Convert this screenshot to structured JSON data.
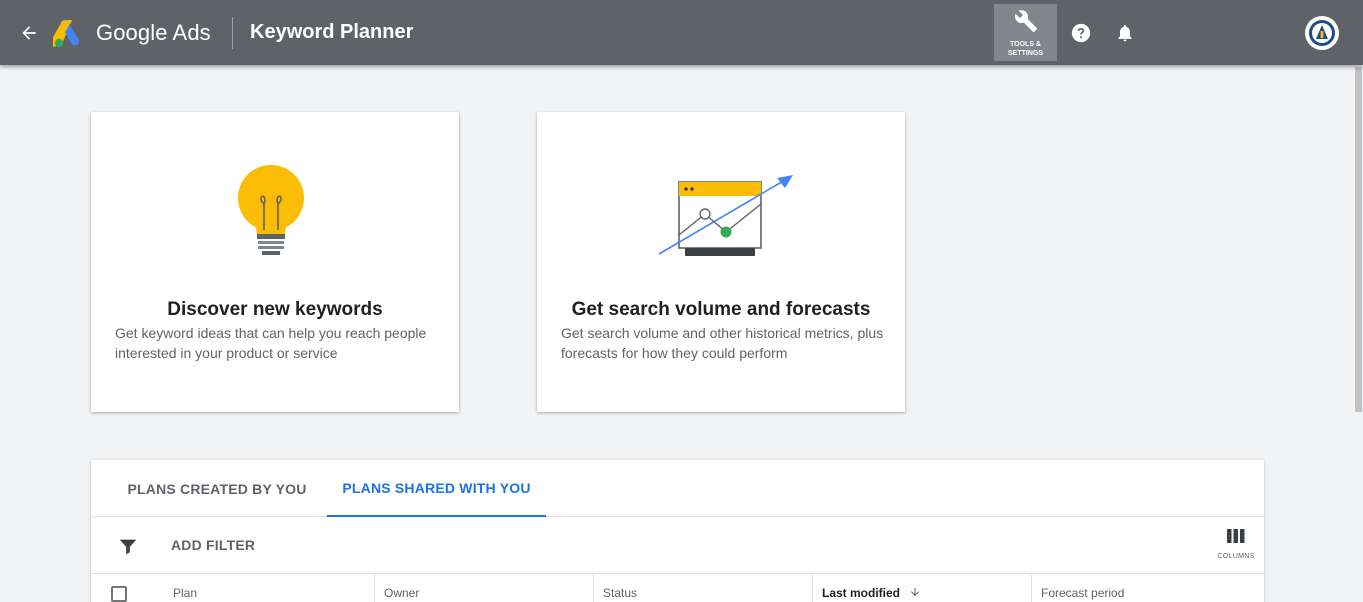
{
  "header": {
    "product_name": "Google Ads",
    "page_title": "Keyword Planner",
    "tools_label": "TOOLS & SETTINGS",
    "icons": [
      "back-arrow-icon",
      "google-ads-logo",
      "wrench-icon",
      "help-icon",
      "bell-icon",
      "avatar"
    ]
  },
  "cards": [
    {
      "title": "Discover new keywords",
      "description": "Get keyword ideas that can help you reach people interested in your product or service",
      "icon": "lightbulb-icon"
    },
    {
      "title": "Get search volume and forecasts",
      "description": "Get search volume and other historical metrics, plus forecasts for how they could perform",
      "icon": "chart-trend-icon"
    }
  ],
  "tabs": [
    {
      "label": "PLANS CREATED BY YOU",
      "active": false
    },
    {
      "label": "PLANS SHARED WITH YOU",
      "active": true
    }
  ],
  "toolbar": {
    "add_filter_label": "ADD FILTER",
    "columns_label": "COLUMNS"
  },
  "table": {
    "columns": [
      "Plan",
      "Owner",
      "Status",
      "Last modified",
      "Forecast period"
    ],
    "sorted_column": "Last modified",
    "sort_direction": "descending"
  },
  "colors": {
    "header_bg": "#5f6368",
    "accent": "#1a73e8",
    "bulb": "#fbbc04",
    "page_bg": "#f1f3f4"
  }
}
